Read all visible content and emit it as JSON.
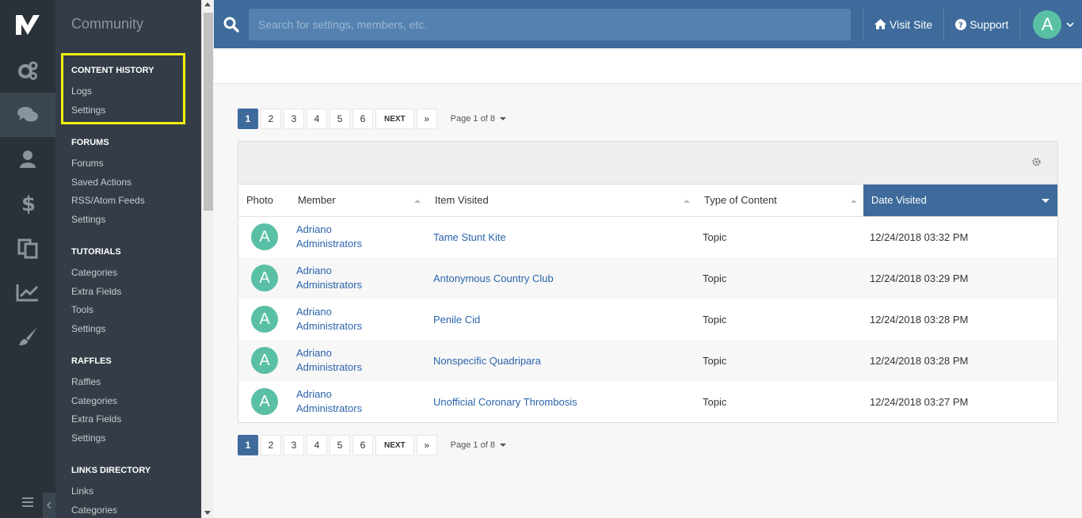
{
  "menu": {
    "title": "Community",
    "sections": [
      {
        "heading": "CONTENT HISTORY",
        "items": [
          "Logs",
          "Settings"
        ]
      },
      {
        "heading": "FORUMS",
        "items": [
          "Forums",
          "Saved Actions",
          "RSS/Atom Feeds",
          "Settings"
        ]
      },
      {
        "heading": "TUTORIALS",
        "items": [
          "Categories",
          "Extra Fields",
          "Tools",
          "Settings"
        ]
      },
      {
        "heading": "RAFFLES",
        "items": [
          "Raffles",
          "Categories",
          "Extra Fields",
          "Settings"
        ]
      },
      {
        "heading": "LINKS DIRECTORY",
        "items": [
          "Links",
          "Categories"
        ]
      }
    ]
  },
  "rail": {
    "items": [
      "gears-icon",
      "chat-bubbles-icon",
      "user-icon",
      "dollar-icon",
      "clipboard-icon",
      "chart-icon",
      "brush-icon"
    ],
    "active_index": 1
  },
  "header": {
    "search_placeholder": "Search for settings, members, etc.",
    "visit_site": "Visit Site",
    "support": "Support",
    "avatar_letter": "A"
  },
  "pagination": {
    "pages": [
      "1",
      "2",
      "3",
      "4",
      "5",
      "6"
    ],
    "active": "1",
    "next_label": "NEXT",
    "last_label": "»",
    "page_of": "Page 1 of 8"
  },
  "table": {
    "columns": [
      "Photo",
      "Member",
      "Item Visited",
      "Type of Content",
      "Date Visited"
    ],
    "sorted_column": "Date Visited",
    "rows": [
      {
        "avatar": "A",
        "member_name": "Adriano",
        "member_group": "Administrators",
        "item": "Tame Stunt Kite",
        "type": "Topic",
        "date": "12/24/2018 03:32 PM"
      },
      {
        "avatar": "A",
        "member_name": "Adriano",
        "member_group": "Administrators",
        "item": "Antonymous Country Club",
        "type": "Topic",
        "date": "12/24/2018 03:29 PM"
      },
      {
        "avatar": "A",
        "member_name": "Adriano",
        "member_group": "Administrators",
        "item": "Penile Cid",
        "type": "Topic",
        "date": "12/24/2018 03:28 PM"
      },
      {
        "avatar": "A",
        "member_name": "Adriano",
        "member_group": "Administrators",
        "item": "Nonspecific Quadripara",
        "type": "Topic",
        "date": "12/24/2018 03:28 PM"
      },
      {
        "avatar": "A",
        "member_name": "Adriano",
        "member_group": "Administrators",
        "item": "Unofficial Coronary Thrombosis",
        "type": "Topic",
        "date": "12/24/2018 03:27 PM"
      }
    ]
  },
  "colors": {
    "header_blue": "#3e6b9b",
    "rail_dark": "#2a3139",
    "menu_dark": "#343d47",
    "avatar_green": "#5ac0a5",
    "link_blue": "#2b64ad",
    "highlight_yellow": "#f1f10f"
  }
}
